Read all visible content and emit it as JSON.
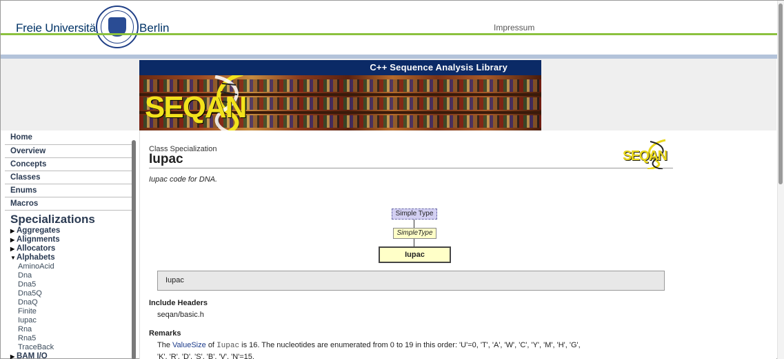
{
  "header": {
    "logo_left": "Freie Universität",
    "logo_right": "Berlin",
    "seal": "fu-berlin-seal-icon",
    "impressum": "Impressum"
  },
  "banner": {
    "subtitle": "C++ Sequence Analysis Library",
    "logo_text": "SEQAN"
  },
  "sidebar": {
    "nav": [
      {
        "label": "Home"
      },
      {
        "label": "Overview"
      },
      {
        "label": "Concepts"
      },
      {
        "label": "Classes"
      },
      {
        "label": "Enums"
      },
      {
        "label": "Macros"
      }
    ],
    "section_title": "Specializations",
    "categories": [
      {
        "label": "Aggregates",
        "expanded": false
      },
      {
        "label": "Alignments",
        "expanded": false
      },
      {
        "label": "Allocators",
        "expanded": false
      },
      {
        "label": "Alphabets",
        "expanded": true
      }
    ],
    "alphabet_items": [
      "AminoAcid",
      "Dna",
      "Dna5",
      "Dna5Q",
      "DnaQ",
      "Finite",
      "Iupac",
      "Rna",
      "Rna5",
      "TraceBack"
    ],
    "more_category": {
      "label": "BAM I/O",
      "expanded": false
    }
  },
  "main": {
    "kind": "Class Specialization",
    "title": "Iupac",
    "small_logo": "SEQAN",
    "summary": "Iupac code for DNA.",
    "diagram": {
      "node1": "Simple Type",
      "node2": "SimpleType",
      "node3": "Iupac"
    },
    "signature": "Iupac",
    "include_heading": "Include Headers",
    "include_value": "seqan/basic.h",
    "remarks_heading": "Remarks",
    "remarks_pre": "The",
    "remarks_link": "ValueSize",
    "remarks_of": "of",
    "remarks_code": "Iupac",
    "remarks_post": "is 16. The nucleotides are enumerated from 0 to 19 in this order: 'U'=0, 'T', 'A', 'W', 'C', 'Y', 'M', 'H', 'G',",
    "remarks_line2": "'K', 'R', 'D', 'S', 'B', 'V', 'N'=15."
  },
  "colors": {
    "fu_blue": "#003366",
    "fu_green": "#8bc13f",
    "banner_navy": "#0b2a66",
    "seqan_yellow": "#f2e21c",
    "diagram_lavender": "#d3d0f2",
    "diagram_yellow": "#ffffc8"
  }
}
